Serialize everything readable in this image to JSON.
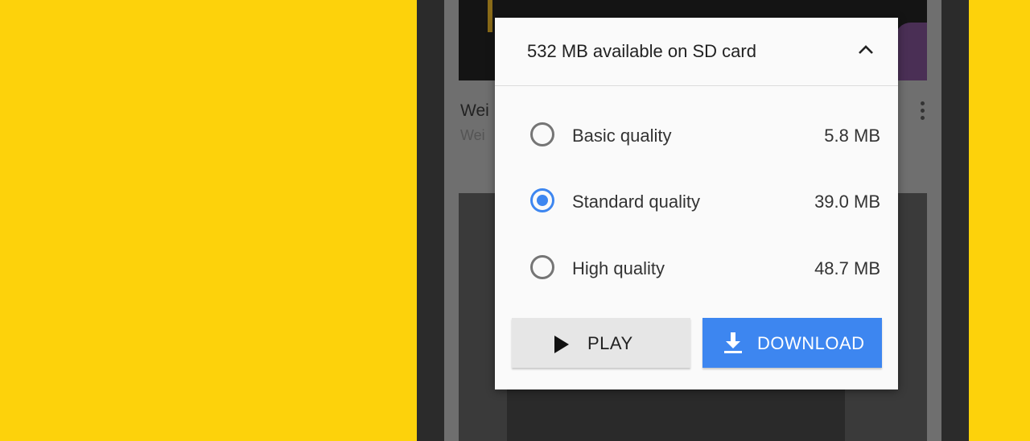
{
  "background": {
    "color": "#FDD20B"
  },
  "video_list": {
    "card_title_partial": "Wei",
    "card_subtitle_partial": "Wei",
    "more_icon": "more-vert-icon"
  },
  "dialog": {
    "storage_text": "532 MB available on SD card",
    "collapse_icon": "chevron-up-icon",
    "options": [
      {
        "label": "Basic quality",
        "size": "5.8 MB",
        "selected": false
      },
      {
        "label": "Standard quality",
        "size": "39.0 MB",
        "selected": true
      },
      {
        "label": "High quality",
        "size": "48.7 MB",
        "selected": false
      }
    ],
    "play_label": "PLAY",
    "play_icon": "play-icon",
    "download_label": "DOWNLOAD",
    "download_icon": "download-icon",
    "accent_color": "#3D86F0"
  }
}
